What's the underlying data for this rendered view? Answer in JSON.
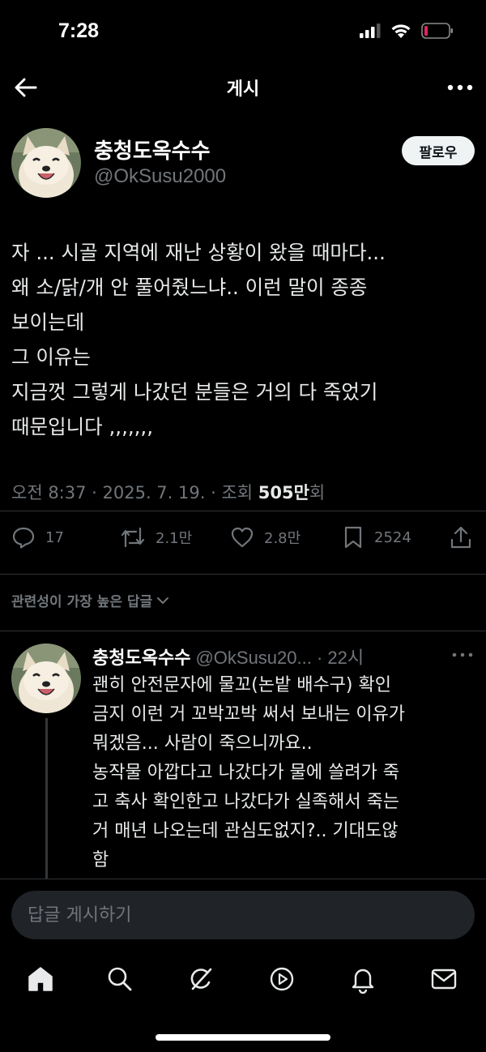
{
  "status_bar": {
    "time": "7:28"
  },
  "nav": {
    "title": "게시"
  },
  "post": {
    "author_name": "충청도옥수수",
    "author_handle": "@OkSusu2000",
    "follow_label": "팔로우",
    "body_lines": [
      "자 ... 시골 지역에 재난 상황이 왔을 때마다...",
      "왜 소/닭/개 안 풀어줬느냐.. 이런 말이 종종",
      "보이는데",
      "그 이유는",
      "지금껏 그렇게 나갔던 분들은 거의 다 죽었기",
      "때문입니다 ,,,,,,,"
    ],
    "meta_prefix": "오전 8:37 · 2025. 7. 19. · 조회 ",
    "views_count": "505만",
    "views_suffix": "회",
    "replies": "17",
    "reposts": "2.1만",
    "likes": "2.8만",
    "bookmarks": "2524"
  },
  "sort_label": "관련성이 가장 높은 답글",
  "reply": {
    "author_name": "충청도옥수수",
    "handle_time": "@OkSusu20... · 22시",
    "body_lines": [
      "괜히 안전문자에 물꼬(논밭 배수구) 확인",
      "금지 이런 거 꼬박꼬박 써서 보내는 이유가",
      "뭐겠음... 사람이 죽으니까요..",
      "농작물 아깝다고 나갔다가 물에 쓸려가 죽",
      "고 축사 확인한고 나갔다가 실족해서 죽는",
      "거 매년 나오는데 관심도없지?.. 기대도않",
      "함"
    ]
  },
  "compose": {
    "placeholder": "답글 게시하기"
  },
  "tabs": [
    "home-icon",
    "search-icon",
    "grok-icon",
    "media-icon",
    "notifications-icon",
    "messages-icon"
  ],
  "colors": {
    "background": "#000000",
    "text": "#e7e9ea",
    "muted": "#71767b",
    "divider": "#2f3336",
    "battery_low": "#e0245e"
  }
}
